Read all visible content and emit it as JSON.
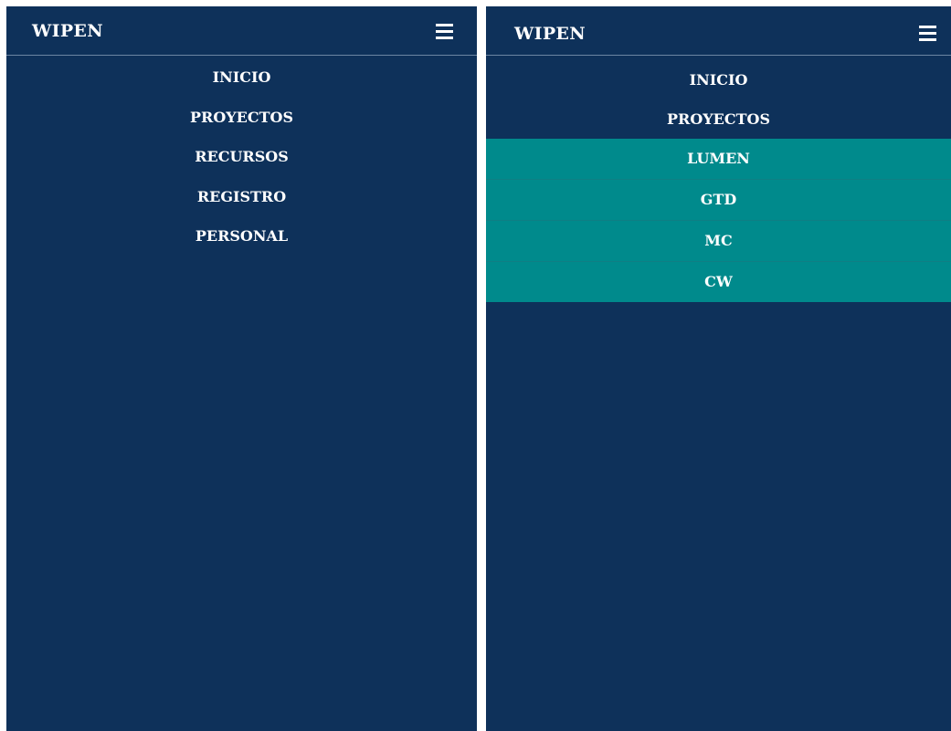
{
  "left_panel": {
    "brand": "WIPEN",
    "menu_icon": "hamburger-icon",
    "menu": [
      {
        "label": "INICIO"
      },
      {
        "label": "PROYECTOS"
      },
      {
        "label": "RECURSOS"
      },
      {
        "label": "REGISTRO"
      },
      {
        "label": "PERSONAL"
      }
    ]
  },
  "right_panel": {
    "brand": "WIPEN",
    "menu_icon": "hamburger-icon",
    "menu": [
      {
        "label": "INICIO"
      },
      {
        "label": "PROYECTOS"
      }
    ],
    "submenu": [
      {
        "label": "LUMEN"
      },
      {
        "label": "GTD"
      },
      {
        "label": "MC"
      },
      {
        "label": "CW"
      }
    ]
  },
  "colors": {
    "navbar_bg": "#0e315a",
    "submenu_bg": "#008a8c",
    "text": "#ffffff"
  }
}
